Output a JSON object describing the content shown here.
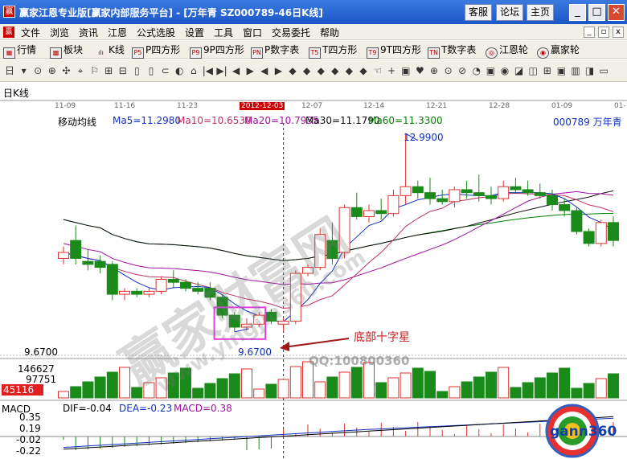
{
  "window": {
    "title": "赢家江恩专业版[赢家内部服务平台] - [万年青   SZ000789-46日K线]",
    "buttons": [
      "客服",
      "论坛",
      "主页"
    ],
    "controls": {
      "minimize": "_",
      "maximize": "□",
      "close": "✕"
    }
  },
  "menu": [
    "文件",
    "浏览",
    "资讯",
    "江恩",
    "公式选股",
    "设置",
    "工具",
    "窗口",
    "交易委托",
    "帮助"
  ],
  "toolbar1": [
    "行情",
    "板块",
    "K线",
    "P四方形",
    "9P四方形",
    "P数字表",
    "T四方形",
    "9T四方形",
    "T数字表",
    "江恩轮",
    "赢家轮"
  ],
  "chart": {
    "period_label": "日K线",
    "indicator_title": "移动均线",
    "ma_labels": [
      {
        "text": "Ma5=11.2980",
        "color": "#1030c0"
      },
      {
        "text": "Ma10=10.6530",
        "color": "#c03060"
      },
      {
        "text": "Ma20=10.7935",
        "color": "#a010a0"
      },
      {
        "text": "Ma30=11.1790",
        "color": "#101010"
      },
      {
        "text": "Ma60=11.3300",
        "color": "#008000"
      }
    ],
    "stock": "000789 万年青",
    "dates": [
      "11-09",
      "11-16",
      "11-23",
      "2012-12-03",
      "12-07",
      "12-14",
      "12-21",
      "12-28",
      "01-09",
      "01-1"
    ],
    "selected_date": "2012-12-03",
    "high_label": "12.9900",
    "low_label": "9.6700",
    "low_axis": "9.6700",
    "annotation": "底部十字星",
    "qq": "QQ:100800360",
    "vol_axis": [
      "146627",
      "97751",
      "45116"
    ],
    "macd_line": {
      "name": "MACD",
      "dif": "DIF=-0.04",
      "dea": "DEA=-0.23",
      "macd": "MACD=0.38"
    },
    "macd_axis": [
      "0.35",
      "0.19",
      "-0.02",
      "-0.22"
    ],
    "watermarks": [
      "赢家财富网",
      "www.yingjia360.com"
    ],
    "gann_logo": "gann360",
    "colors": {
      "up": "#e03030",
      "down": "#1a8a1a",
      "ma5": "#1030c0",
      "ma10": "#c03060",
      "ma20": "#a010a0",
      "ma30": "#101010",
      "ma60": "#008000",
      "highlight_box": "#e040e0"
    }
  },
  "chart_data": {
    "type": "candlestick",
    "candles_ohlc": [
      [
        10.9,
        11.1,
        10.8,
        11.0
      ],
      [
        11.2,
        11.45,
        10.8,
        10.9
      ],
      [
        10.85,
        11.05,
        10.7,
        10.8
      ],
      [
        10.85,
        10.95,
        10.65,
        10.75
      ],
      [
        10.8,
        10.85,
        10.2,
        10.3
      ],
      [
        10.3,
        10.4,
        10.2,
        10.35
      ],
      [
        10.35,
        10.4,
        10.25,
        10.3
      ],
      [
        10.3,
        10.4,
        10.25,
        10.35
      ],
      [
        10.35,
        10.6,
        10.3,
        10.55
      ],
      [
        10.55,
        10.7,
        10.4,
        10.5
      ],
      [
        10.5,
        10.55,
        10.35,
        10.4
      ],
      [
        10.4,
        10.5,
        10.3,
        10.35
      ],
      [
        10.4,
        10.5,
        10.2,
        10.25
      ],
      [
        10.25,
        10.3,
        9.9,
        9.95
      ],
      [
        9.95,
        10.0,
        9.67,
        9.75
      ],
      [
        9.75,
        9.9,
        9.7,
        9.8
      ],
      [
        9.8,
        10.0,
        9.75,
        9.95
      ],
      [
        10.0,
        10.05,
        9.8,
        9.85
      ],
      [
        9.8,
        9.9,
        9.68,
        9.85
      ],
      [
        9.85,
        10.7,
        9.8,
        10.65
      ],
      [
        10.65,
        10.8,
        10.6,
        10.75
      ],
      [
        10.75,
        11.4,
        10.7,
        11.3
      ],
      [
        11.2,
        11.5,
        10.8,
        10.9
      ],
      [
        11.0,
        11.8,
        10.9,
        11.75
      ],
      [
        11.75,
        12.0,
        11.55,
        11.6
      ],
      [
        11.6,
        11.8,
        11.5,
        11.7
      ],
      [
        11.7,
        11.9,
        11.55,
        11.65
      ],
      [
        11.65,
        12.05,
        11.6,
        11.95
      ],
      [
        11.95,
        12.99,
        11.8,
        12.1
      ],
      [
        12.1,
        12.2,
        11.9,
        12.0
      ],
      [
        12.0,
        12.25,
        11.8,
        11.9
      ],
      [
        11.9,
        12.05,
        11.8,
        11.85
      ],
      [
        11.85,
        12.1,
        11.75,
        12.05
      ],
      [
        12.05,
        12.2,
        11.9,
        12.0
      ],
      [
        12.0,
        12.3,
        11.85,
        11.95
      ],
      [
        11.95,
        12.1,
        11.8,
        11.9
      ],
      [
        11.9,
        12.2,
        11.85,
        12.1
      ],
      [
        12.1,
        12.25,
        12.0,
        12.05
      ],
      [
        12.05,
        12.2,
        11.95,
        12.0
      ],
      [
        12.0,
        12.15,
        11.9,
        11.95
      ],
      [
        11.95,
        12.05,
        11.7,
        11.8
      ],
      [
        11.8,
        11.9,
        11.6,
        11.7
      ],
      [
        11.7,
        11.75,
        11.3,
        11.35
      ],
      [
        11.35,
        11.4,
        11.1,
        11.15
      ],
      [
        11.15,
        11.55,
        11.1,
        11.5
      ],
      [
        11.5,
        11.6,
        11.1,
        11.2
      ]
    ],
    "y_range": [
      9.4,
      13.3
    ],
    "annotations": [
      {
        "label": "12.9900",
        "value": 12.99
      },
      {
        "label": "9.6700",
        "value": 9.67
      },
      {
        "label": "底部十字星"
      }
    ]
  }
}
